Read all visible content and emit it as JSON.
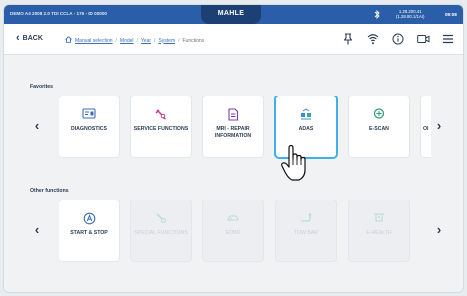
{
  "topbar": {
    "vehicle": "DEMO A4 2008 2.0 TDI CCLA - 175 - ID 00000",
    "brand": "MAHLE",
    "ip_line1": "1.28.200.41",
    "ip_line2": "(1.28.80.1/1AI)",
    "clock": "09:08"
  },
  "nav": {
    "back_label": "BACK",
    "breadcrumbs": [
      "Manual selection",
      "Model",
      "Year",
      "System"
    ],
    "current": "Functions",
    "separator": "/"
  },
  "icons": {
    "home": "home-icon",
    "pin": "pin-icon",
    "signal": "signal-icon",
    "info": "info-icon",
    "camera": "camera-icon",
    "menu": "menu-icon"
  },
  "colors": {
    "accent": "#2a5ea8",
    "selected_border": "#41b0e8",
    "icon_blue": "#3a6fb8",
    "icon_pink": "#c0408f",
    "icon_green": "#2e9a6f"
  },
  "favorites": {
    "title": "Favorites",
    "tiles": [
      {
        "label": "DIAGNOSTICS",
        "icon": "diagnostics-icon"
      },
      {
        "label": "SERVICE FUNCTIONS",
        "icon": "service-functions-icon"
      },
      {
        "label": "MRI - REPAIR INFORMATION",
        "icon": "repair-info-icon"
      },
      {
        "label": "ADAS",
        "icon": "adas-icon"
      },
      {
        "label": "E-SCAN",
        "icon": "e-scan-icon"
      },
      {
        "label": "OI",
        "icon": ""
      }
    ]
  },
  "other": {
    "title": "Other functions",
    "tiles": [
      {
        "label": "START & STOP",
        "icon": "start-stop-icon"
      },
      {
        "label": "SPECIAL FUNCTIONS",
        "icon": "special-functions-icon"
      },
      {
        "label": "EOBD",
        "icon": "eobd-icon"
      },
      {
        "label": "TOW BAR",
        "icon": "tow-bar-icon"
      },
      {
        "label": "E-HEALTH",
        "icon": "e-health-icon"
      }
    ]
  }
}
